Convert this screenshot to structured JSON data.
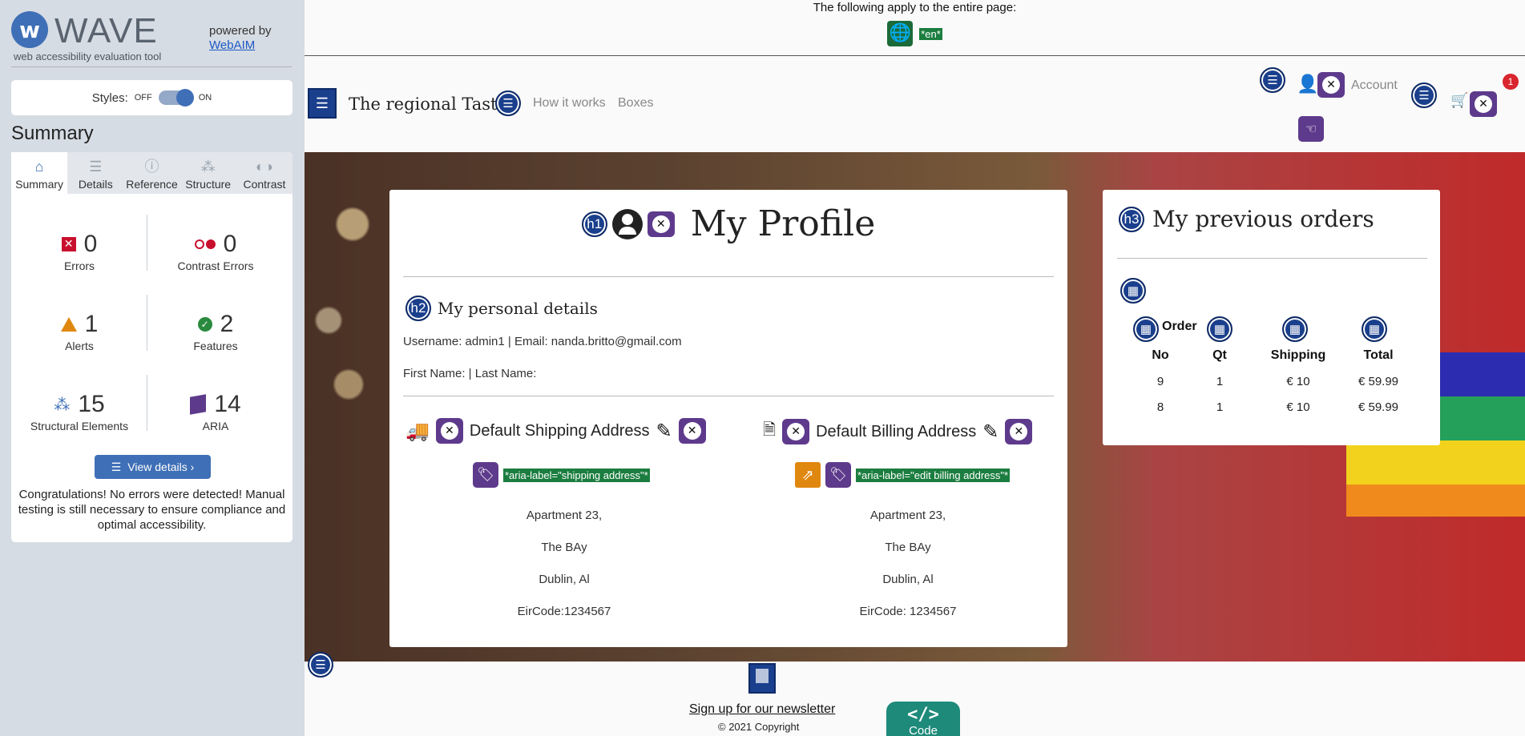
{
  "wave": {
    "title": "WAVE",
    "subtitle": "web accessibility evaluation tool",
    "powered_by": "powered by",
    "webaim": "WebAIM",
    "styles_label": "Styles:",
    "styles_off": "OFF",
    "styles_on": "ON",
    "summary_heading": "Summary",
    "tabs": [
      {
        "label": "Summary",
        "icon": "home-icon"
      },
      {
        "label": "Details",
        "icon": "list-icon"
      },
      {
        "label": "Reference",
        "icon": "info-icon"
      },
      {
        "label": "Structure",
        "icon": "sitemap-icon"
      },
      {
        "label": "Contrast",
        "icon": "contrast-icon"
      }
    ],
    "stats": {
      "errors": {
        "count": "0",
        "label": "Errors"
      },
      "contrast_errors": {
        "count": "0",
        "label": "Contrast Errors"
      },
      "alerts": {
        "count": "1",
        "label": "Alerts"
      },
      "features": {
        "count": "2",
        "label": "Features"
      },
      "structural": {
        "count": "15",
        "label": "Structural Elements"
      },
      "aria": {
        "count": "14",
        "label": "ARIA"
      }
    },
    "view_details": "View details ›",
    "congrats": "Congratulations! No errors were detected! Manual testing is still necessary to ensure compliance and optimal accessibility."
  },
  "page": {
    "banner_text": "The following apply to the entire page:",
    "lang_tag": "*en*",
    "brand": "The regional Taste",
    "nav": [
      "How it works",
      "Boxes"
    ],
    "account": "Account",
    "cart_count": "1",
    "profile": {
      "h1_badge": "h1",
      "title": "My Profile",
      "h2_badge": "h2",
      "personal_heading": "My personal details",
      "user_line": "Username: admin1 | Email: nanda.britto@gmail.com",
      "name_line": "First Name: | Last Name:",
      "shipping": {
        "heading": "Default Shipping Address",
        "aria_label": "*aria-label=\"shipping address\"*",
        "lines": [
          "Apartment 23,",
          "The BAy",
          "Dublin, Al",
          "EirCode:1234567"
        ]
      },
      "billing": {
        "heading": "Default Billing Address",
        "aria_label": "*aria-label=\"edit billing address\"*",
        "lines": [
          "Apartment 23,",
          "The BAy",
          "Dublin, Al",
          "EirCode: 1234567"
        ]
      }
    },
    "orders": {
      "h3_badge": "h3",
      "title": "My previous orders",
      "header_top": "Order",
      "columns": [
        "No",
        "Qt",
        "Shipping",
        "Total"
      ],
      "rows": [
        [
          "9",
          "1",
          "€ 10",
          "€ 59.99"
        ],
        [
          "8",
          "1",
          "€ 10",
          "€ 59.99"
        ]
      ]
    },
    "footer": {
      "newsletter": "Sign up for our newsletter",
      "copyright": "© 2021 Copyright",
      "code_label": "Code",
      "code_glyph": "</>"
    }
  }
}
